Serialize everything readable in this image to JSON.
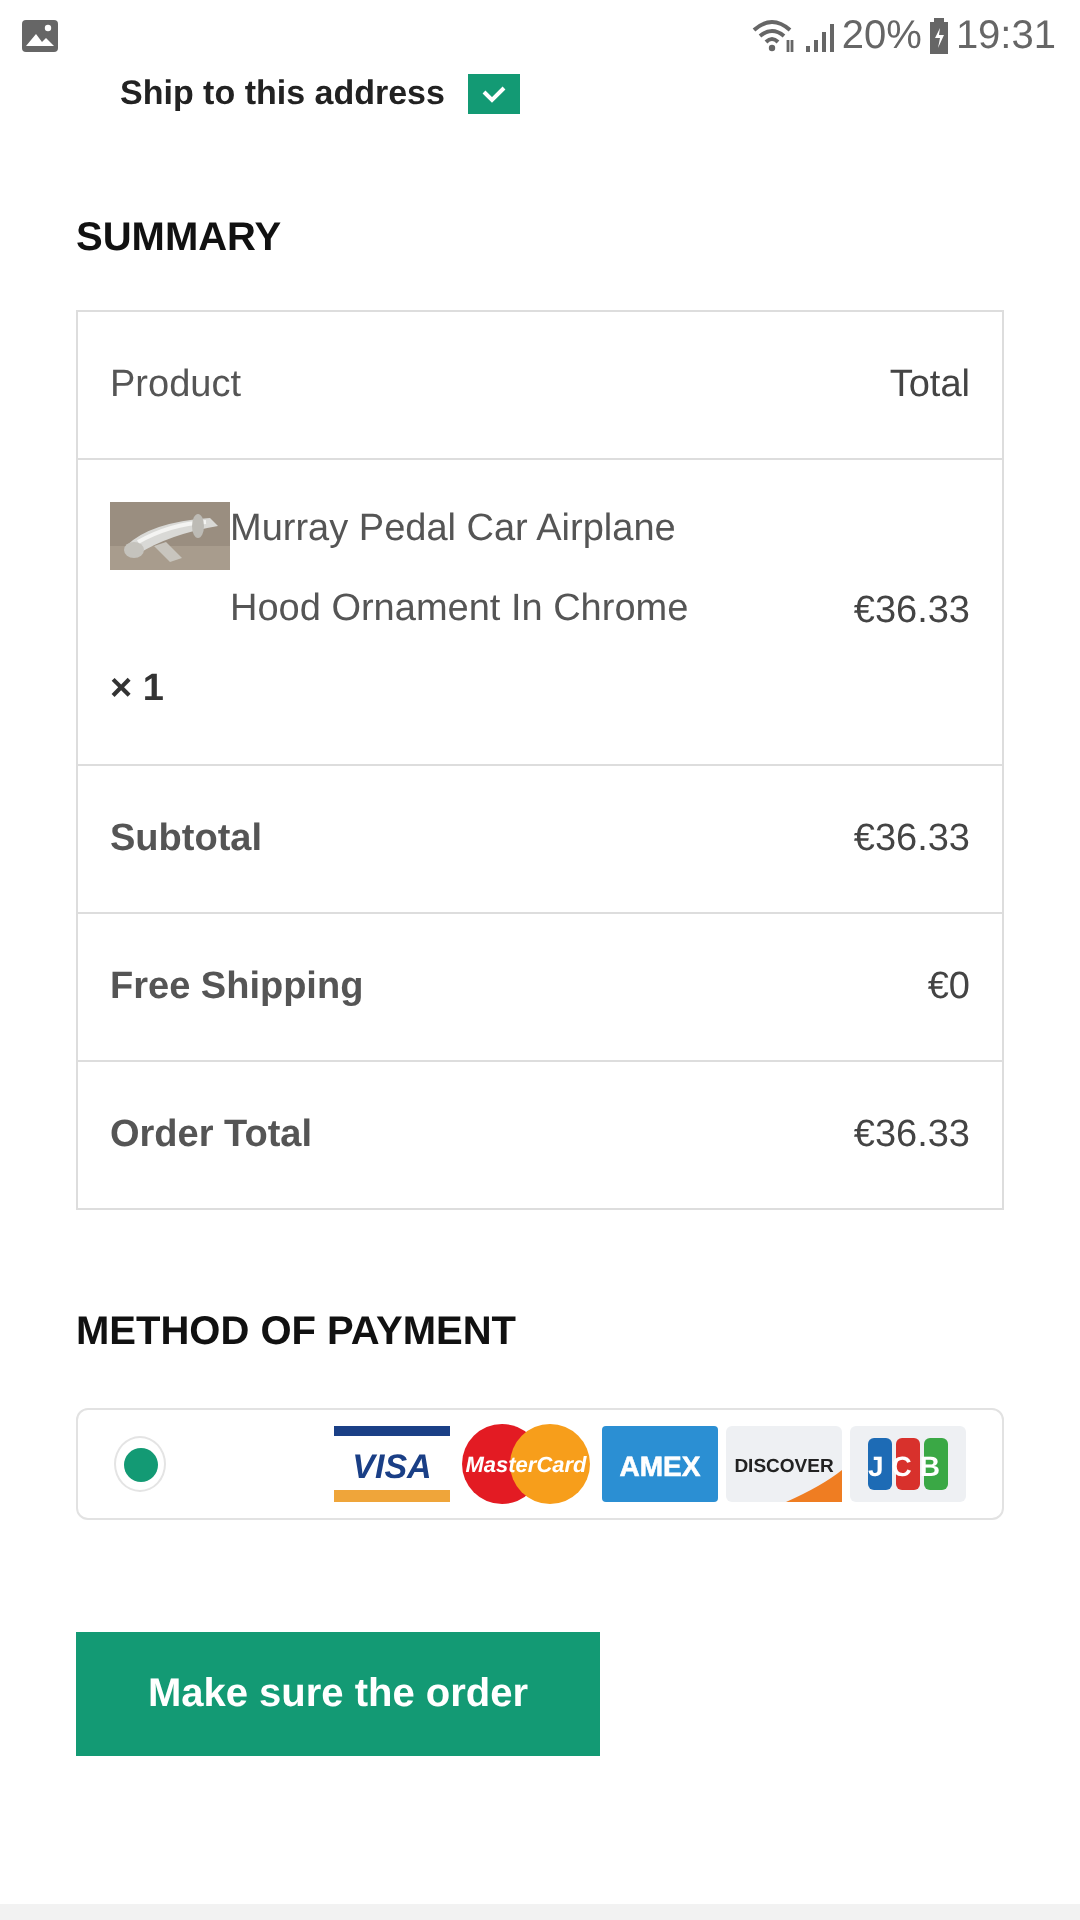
{
  "status_bar": {
    "battery": "20%",
    "time": "19:31"
  },
  "ship_to_address": {
    "label": "Ship to this address",
    "checked": true
  },
  "summary": {
    "title": "SUMMARY",
    "columns": [
      "Product",
      "Total"
    ],
    "item": {
      "kind": "picture",
      "name": "Murray Pedal Car Airplane Hood Ornament In Chrome",
      "quantity": "× 1",
      "total": "€36.33"
    },
    "totals": [
      {
        "label": "Subtotal",
        "value": "€36.33"
      },
      {
        "label": "Free Shipping",
        "value": "€0"
      },
      {
        "label": "Order Total",
        "value": "€36.33"
      }
    ]
  },
  "payment": {
    "title": "METHOD OF PAYMENT",
    "selected": true,
    "cards": [
      {
        "kind": "visa",
        "label": "VISA"
      },
      {
        "kind": "mastercard",
        "label": "MasterCard"
      },
      {
        "kind": "amex",
        "label": "AMEX"
      },
      {
        "kind": "discover",
        "label": "DISCOVER"
      },
      {
        "kind": "jcb",
        "label": "JCB"
      }
    ]
  },
  "submit_button": "Make sure the order"
}
